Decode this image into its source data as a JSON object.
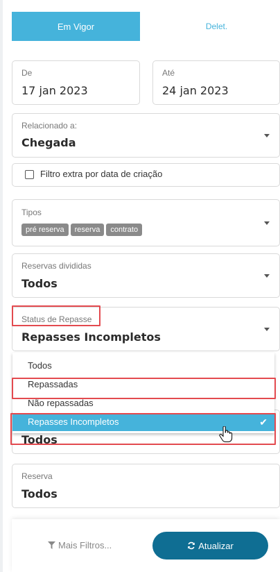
{
  "tabs": {
    "active": "Em Vigor",
    "inactive": "Delet."
  },
  "date_from": {
    "label": "De",
    "value": "17 jan 2023"
  },
  "date_to": {
    "label": "Até",
    "value": "24 jan 2023"
  },
  "related": {
    "label": "Relacionado a:",
    "value": "Chegada"
  },
  "extra_filter": {
    "label": "Filtro extra por data de criação",
    "checked": false
  },
  "types": {
    "label": "Tipos",
    "chips": [
      "pré reserva",
      "reserva",
      "contrato"
    ]
  },
  "split": {
    "label": "Reservas divididas",
    "value": "Todos"
  },
  "repasse": {
    "label": "Status de Repasse",
    "value": "Repasses Incompletos"
  },
  "repasse_options": [
    "Todos",
    "Repassadas",
    "Não repassadas",
    "Repasses Incompletos"
  ],
  "hidden_field_value": "Todos",
  "reserva": {
    "label": "Reserva",
    "value": "Todos"
  },
  "footer": {
    "more_filters": "Mais Filtros...",
    "refresh": "Atualizar"
  },
  "colors": {
    "accent": "#45b3db",
    "primary_button": "#0f6e93",
    "highlight": "#e34a4f"
  }
}
